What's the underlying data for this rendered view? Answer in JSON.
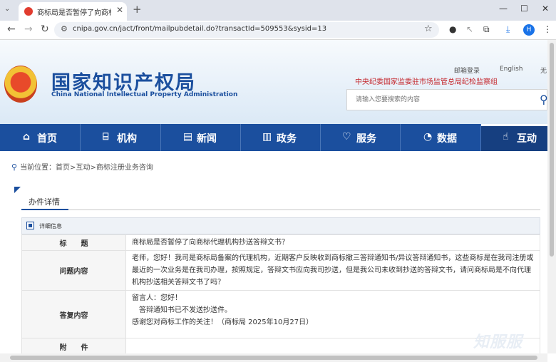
{
  "browser": {
    "tab_title": "商标局是否暂停了向商标代理机构抄送答辩文书？",
    "url": "cnipa.gov.cn/jact/front/mailpubdetail.do?transactId=509553&sysid=13",
    "profile_initial": "H"
  },
  "header": {
    "logo_cn": "国家知识产权局",
    "logo_en": "China National Intellectual Property Administration",
    "links": [
      "邮箱登录",
      "English",
      "无"
    ],
    "subtitle": "中央纪委国家监委驻市场监管总局纪检监察组",
    "search_placeholder": "请输入您要搜索的内容"
  },
  "nav": {
    "items": [
      {
        "label": "首页",
        "icon": "home-icon"
      },
      {
        "label": "机构",
        "icon": "institution-icon"
      },
      {
        "label": "新闻",
        "icon": "news-icon"
      },
      {
        "label": "政务",
        "icon": "document-icon"
      },
      {
        "label": "服务",
        "icon": "service-icon"
      },
      {
        "label": "数据",
        "icon": "chart-icon"
      },
      {
        "label": "互动",
        "icon": "hand-icon"
      }
    ],
    "active_index": 6
  },
  "breadcrumb": "当前位置：首页>互动>商标注册业务咨询",
  "panel": {
    "title": "办件详情",
    "info_label": "详细信息"
  },
  "detail": {
    "title_key": "标　　题",
    "title_value": "商标局是否暂停了向商标代理机构抄送答辩文书？",
    "question_key": "问题内容",
    "question_value": "老师，您好！我司是商标局备案的代理机构，近期客户反映收到商标撤三答辩通知书/异议答辩通知书，这些商标是在我司注册或最近的一次业务是在我司办理，按照规定，答辩文书应向我司抄送，但是我公司未收到抄送的答辩文书，请问商标局是不向代理机构抄送相关答辩文书了吗？",
    "answer_key": "答复内容",
    "answer_lines": [
      "留言人：您好！",
      "　答辩通知书已不发送抄送件。",
      "感谢您对商标工作的关注！（商标局 2025年10月27日）"
    ],
    "attachment_key": "附　　件",
    "attachment_value": ""
  },
  "watermark": "知服服"
}
